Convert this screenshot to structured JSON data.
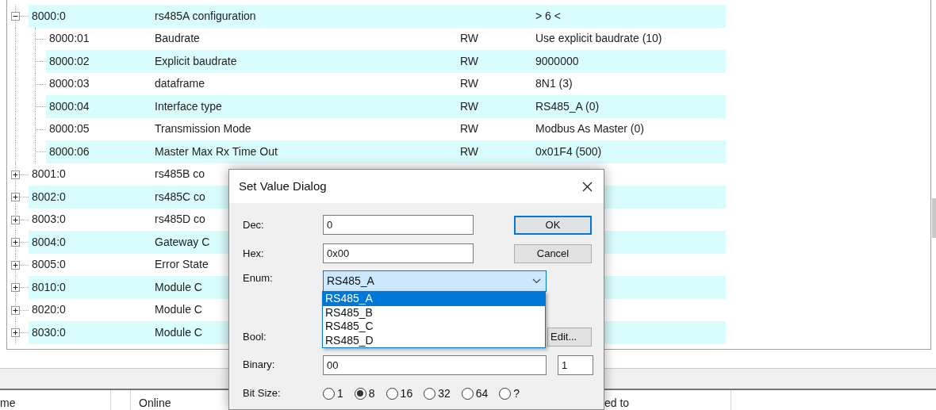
{
  "tree": {
    "rows": [
      {
        "index": "8000:0",
        "name": "rs485A configuration",
        "value": "> 6 <",
        "expanded": true,
        "children": [
          {
            "index": "8000:01",
            "name": "Baudrate",
            "flags": "RW",
            "value": "Use explicit baudrate (10)"
          },
          {
            "index": "8000:02",
            "name": "Explicit baudrate",
            "flags": "RW",
            "value": "9000000"
          },
          {
            "index": "8000:03",
            "name": "dataframe",
            "flags": "RW",
            "value": "8N1 (3)"
          },
          {
            "index": "8000:04",
            "name": "Interface type",
            "flags": "RW",
            "value": "RS485_A (0)"
          },
          {
            "index": "8000:05",
            "name": "Transmission Mode",
            "flags": "RW",
            "value": "Modbus As Master (0)"
          },
          {
            "index": "8000:06",
            "name": "Master Max Rx Time Out",
            "flags": "RW",
            "value": "0x01F4 (500)"
          }
        ]
      },
      {
        "index": "8001:0",
        "name": "rs485B co",
        "expanded": false
      },
      {
        "index": "8002:0",
        "name": "rs485C co",
        "expanded": false
      },
      {
        "index": "8003:0",
        "name": "rs485D co",
        "expanded": false
      },
      {
        "index": "8004:0",
        "name": "Gateway C",
        "expanded": false
      },
      {
        "index": "8005:0",
        "name": "Error State",
        "expanded": false
      },
      {
        "index": "8010:0",
        "name": "Module C",
        "expanded": false
      },
      {
        "index": "8020:0",
        "name": "Module C",
        "expanded": false
      },
      {
        "index": "8030:0",
        "name": "Module C",
        "expanded": false
      }
    ]
  },
  "list_header": {
    "cells": [
      "me",
      "Online",
      "ed to"
    ]
  },
  "dialog": {
    "title": "Set Value Dialog",
    "dec": {
      "label": "Dec:",
      "value": "0"
    },
    "hex": {
      "label": "Hex:",
      "value": "0x00"
    },
    "enum": {
      "label": "Enum:",
      "value": "RS485_A",
      "expanded": true,
      "options": [
        {
          "label": "RS485_A",
          "selected": true
        },
        {
          "label": "RS485_B",
          "selected": false
        },
        {
          "label": "RS485_C",
          "selected": false
        },
        {
          "label": "RS485_D",
          "selected": false
        }
      ]
    },
    "bool": {
      "label": "Bool:"
    },
    "edit_button": "Edit...",
    "binary": {
      "label": "Binary:",
      "value": "00"
    },
    "bit_count": "1",
    "bit_size": {
      "label": "Bit Size:",
      "options": [
        {
          "label": "1",
          "selected": false
        },
        {
          "label": "8",
          "selected": true
        },
        {
          "label": "16",
          "selected": false
        },
        {
          "label": "32",
          "selected": false
        },
        {
          "label": "64",
          "selected": false
        },
        {
          "label": "?",
          "selected": false
        }
      ]
    },
    "buttons": [
      {
        "label": "OK",
        "default": true
      },
      {
        "label": "Cancel",
        "default": false
      }
    ]
  }
}
